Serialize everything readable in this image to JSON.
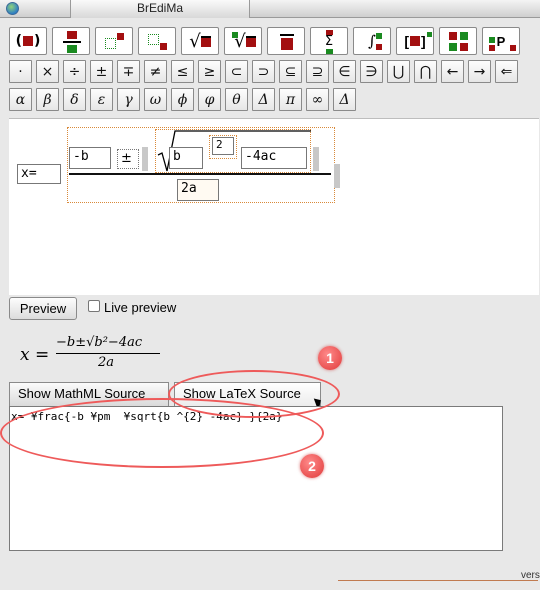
{
  "window": {
    "title": "BrEdiMa"
  },
  "toolbar": {
    "row1": [
      {
        "name": "parentheses-button",
        "glyph": "(■)"
      },
      {
        "name": "fraction-button",
        "glyph": "fraction"
      },
      {
        "name": "superscript-button",
        "glyph": "sup"
      },
      {
        "name": "subscript-button",
        "glyph": "sub"
      },
      {
        "name": "sqrt-button",
        "glyph": "√"
      },
      {
        "name": "nth-root-button",
        "glyph": "ⁿ√"
      },
      {
        "name": "overbar-button",
        "glyph": "overbar"
      },
      {
        "name": "sum-button",
        "glyph": "Σ"
      },
      {
        "name": "integral-button",
        "glyph": "∫"
      },
      {
        "name": "bracket-button",
        "glyph": "[■]"
      },
      {
        "name": "matrix-button",
        "glyph": "matrix"
      },
      {
        "name": "prescript-button",
        "glyph": "P"
      }
    ],
    "row2": [
      "·",
      "×",
      "÷",
      "±",
      "∓",
      "≠",
      "≤",
      "≥",
      "⊂",
      "⊃",
      "⊆",
      "⊇",
      "∈",
      "∋",
      "⋃",
      "⋂",
      "←",
      "→",
      "⇐"
    ],
    "row3": [
      "α",
      "β",
      "δ",
      "ε",
      "γ",
      "ω",
      "ϕ",
      "φ",
      "θ",
      "Δ",
      "π",
      "∞",
      "Δ"
    ]
  },
  "editor": {
    "lhs": "x=",
    "numerator_left": "-b",
    "pm": "±",
    "radicand_base": "b",
    "exponent": "2",
    "radicand_rest": "-4ac",
    "denominator": "2a"
  },
  "preview": {
    "button_label": "Preview",
    "live_label": "Live preview",
    "rendered": {
      "lhs": "x =",
      "numerator": "−b±√b²−4ac",
      "denominator": "2a"
    }
  },
  "tabs": {
    "mathml_label": "Show MathML Source",
    "latex_label": "Show LaTeX Source"
  },
  "source": {
    "text": "x= ¥frac{-b ¥pm  ¥sqrt{b ^{2} -4ac} }{2a}"
  },
  "annotations": {
    "badge1": "1",
    "badge2": "2"
  },
  "footer": {
    "text": "vers"
  },
  "colors": {
    "accent_red": "#a30f10",
    "accent_green": "#1a8a20",
    "annotation": "#ee5a5a"
  }
}
